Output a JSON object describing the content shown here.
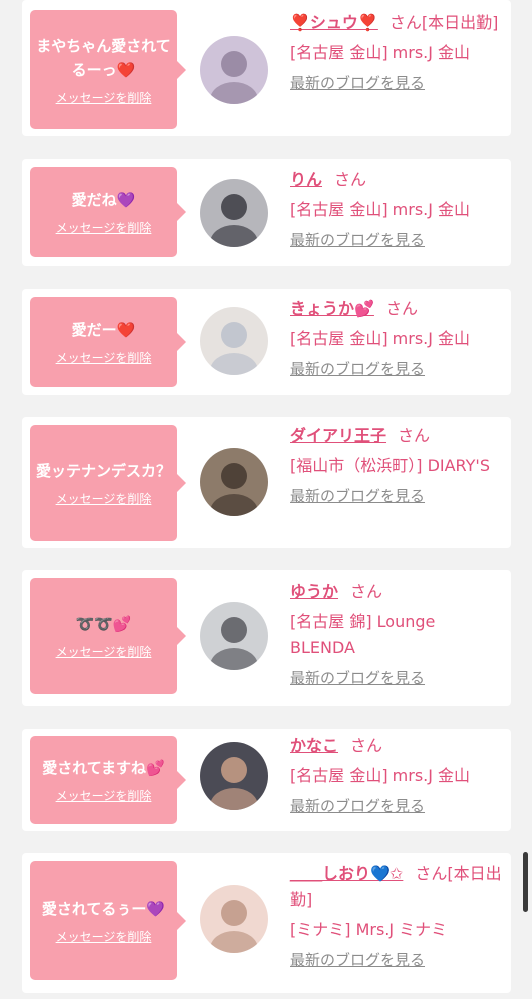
{
  "cards": [
    {
      "message": "まやちゃん愛されてるーっ❤️",
      "delete_label": "メッセージを削除",
      "name": "❣️シュウ❣️",
      "san": "さん",
      "status": "[本日出勤]",
      "shop": "[名古屋 金山] mrs.J 金山",
      "blog_label": "最新のブログを見る",
      "avatar_icon": "avatar-photo-icon"
    },
    {
      "message": "愛だね💜",
      "delete_label": "メッセージを削除",
      "name": "りん",
      "san": "さん",
      "status": "",
      "shop": "[名古屋 金山] mrs.J 金山",
      "blog_label": "最新のブログを見る",
      "avatar_icon": "avatar-photo-icon"
    },
    {
      "message": "愛だー❤️",
      "delete_label": "メッセージを削除",
      "name": "きょうか💕",
      "san": "さん",
      "status": "",
      "shop": "[名古屋 金山] mrs.J 金山",
      "blog_label": "最新のブログを見る",
      "avatar_icon": "avatar-photo-icon"
    },
    {
      "message": "愛ッテナンデスカ？",
      "delete_label": "メッセージを削除",
      "name": "ダイアリ王子",
      "san": "さん",
      "status": "",
      "shop": "[福山市（松浜町）] DIARY'S",
      "blog_label": "最新のブログを見る",
      "avatar_icon": "avatar-photo-icon"
    },
    {
      "message": "➰➰💕",
      "delete_label": "メッセージを削除",
      "name": "ゆうか",
      "san": "さん",
      "status": "",
      "shop": "[名古屋 錦] Lounge BLENDA",
      "blog_label": "最新のブログを見る",
      "avatar_icon": "avatar-photo-icon"
    },
    {
      "message": "愛されてますね💕",
      "delete_label": "メッセージを削除",
      "name": "かなこ",
      "san": "さん",
      "status": "",
      "shop": "[名古屋 金山] mrs.J 金山",
      "blog_label": "最新のブログを見る",
      "avatar_icon": "avatar-photo-icon"
    },
    {
      "message": "愛されてるぅー💜",
      "delete_label": "メッセージを削除",
      "name": "＿＿しおり💙✩",
      "san": "さん",
      "status": "[本日出勤]",
      "shop": "[ミナミ] Mrs.J ミナミ",
      "blog_label": "最新のブログを見る",
      "avatar_icon": "avatar-photo-icon"
    }
  ],
  "colors": {
    "bubble": "#f8a0ad",
    "name": "#e0507a",
    "blog_link": "#8c8c8c",
    "background": "#f2f2f2"
  }
}
